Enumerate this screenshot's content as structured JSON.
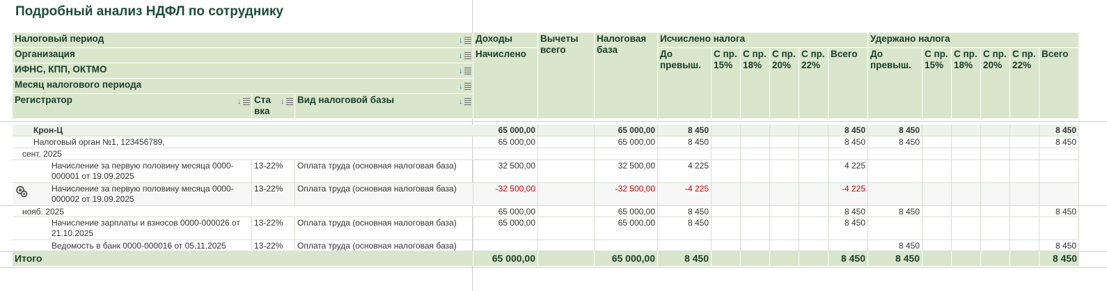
{
  "report": {
    "title": "Подробный анализ НДФЛ по сотруднику"
  },
  "group_headers": {
    "tax_period": "Налоговый период",
    "organization": "Организация",
    "ifns": "ИФНС, КПП, ОКТМО",
    "month": "Месяц налогового периода",
    "registrar": "Регистратор",
    "rate": "Ставка",
    "base_type": "Вид налоговой базы"
  },
  "column_headers": {
    "income": "Доходы",
    "accrued": "Начислено",
    "deductions": "Вычеты всего",
    "tax_base": "Налоговая база",
    "calculated": "Исчислено налога",
    "withheld": "Удержано налога",
    "before": "До превыш.",
    "p15": "С пр. 15%",
    "p18": "С пр. 18%",
    "p20": "С пр. 20%",
    "p22": "С пр. 22%",
    "total": "Всего"
  },
  "rows": [
    {
      "label": "Крон-Ц",
      "accrued": "65 000,00",
      "base": "65 000,00",
      "calc_before": "8 450",
      "calc_total": "8 450",
      "with_before": "8 450",
      "with_total": "8 450"
    },
    {
      "label": "Налоговый орган №1, 123456789,",
      "accrued": "65 000,00",
      "base": "65 000,00",
      "calc_before": "8 450",
      "calc_total": "8 450",
      "with_before": "8 450",
      "with_total": "8 450"
    },
    {
      "label": "сент. 2025"
    },
    {
      "label": "Начисление за первую половину месяца 0000-000001 от 19.09.2025",
      "rate": "13-22%",
      "base_type": "Оплата труда (основная налоговая база)",
      "accrued": "32 500,00",
      "base": "32 500,00",
      "calc_before": "4 225",
      "calc_total": "4 225"
    },
    {
      "label": "Начисление за первую половину месяца 0000-000002 от 19.09.2025",
      "rate": "13-22%",
      "base_type": "Оплата труда (основная налоговая база)",
      "accrued": "-32 500,00",
      "base": "-32 500,00",
      "calc_before": "-4 225",
      "calc_total": "-4 225"
    },
    {
      "label": "нояб. 2025",
      "accrued": "65 000,00",
      "base": "65 000,00",
      "calc_before": "8 450",
      "calc_total": "8 450",
      "with_before": "8 450",
      "with_total": "8 450"
    },
    {
      "label": "Начисление зарплаты и взносов 0000-000026 от 21.10.2025",
      "rate": "13-22%",
      "base_type": "Оплата труда (основная налоговая база)",
      "accrued": "65 000,00",
      "base": "65 000,00",
      "calc_before": "8 450",
      "calc_total": "8 450"
    },
    {
      "label": "Ведомость в банк 0000-000016 от 05.11.2025",
      "rate": "13-22%",
      "base_type": "Оплата труда (основная налоговая база)",
      "with_before": "8 450",
      "with_total": "8 450"
    }
  ],
  "totals": {
    "label": "Итого",
    "accrued": "65 000,00",
    "base": "65 000,00",
    "calc_before": "8 450",
    "calc_total": "8 450",
    "with_before": "8 450",
    "with_total": "8 450"
  },
  "colors": {
    "header_bg": "#d9e6cc",
    "title": "#1e4d38",
    "negative": "#d60000"
  }
}
